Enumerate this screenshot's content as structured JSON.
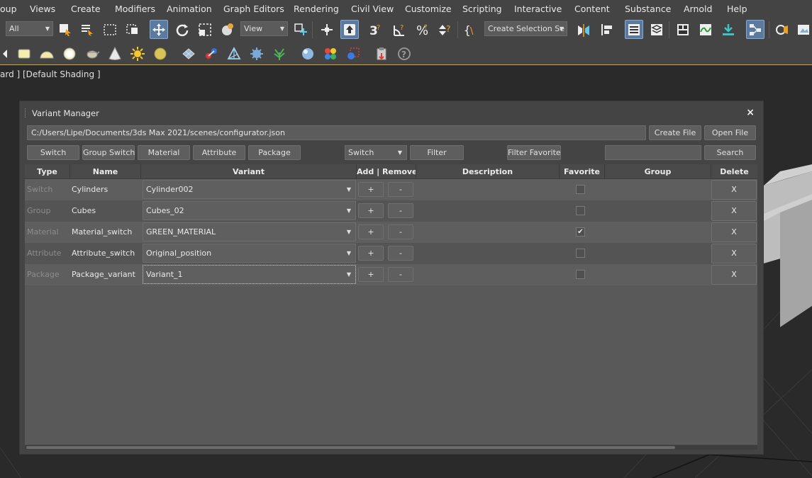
{
  "menubar": {
    "items": [
      "oup",
      "Views",
      "Create",
      "Modifiers",
      "Animation",
      "Graph Editors",
      "Rendering",
      "Civil View",
      "Customize",
      "Scripting",
      "Interactive",
      "Content",
      "Substance",
      "Arnold",
      "Help"
    ]
  },
  "toolbar": {
    "selection_filter": "All",
    "ref_coord": "View",
    "named_selection": "Create Selection Se"
  },
  "viewport": {
    "label": "ard ] [Default Shading ]"
  },
  "dialog": {
    "title": "Variant Manager",
    "close_label": "×",
    "path": "C:/Users/Lipe/Documents/3ds Max 2021/scenes/configurator.json",
    "create_file": "Create File",
    "open_file": "Open File",
    "type_buttons": [
      "Switch",
      "Group Switch",
      "Material",
      "Attribute",
      "Package"
    ],
    "filter_type": "Switch",
    "filter_label": "Filter",
    "filter_favorite_label": "Filter Favorite",
    "search_value": "",
    "search_label": "Search"
  },
  "table": {
    "headers": {
      "type": "Type",
      "name": "Name",
      "variant": "Variant",
      "add_remove": "Add | Remove",
      "description": "Description",
      "favorite": "Favorite",
      "group": "Group",
      "delete": "Delete"
    },
    "rows": [
      {
        "type": "Switch",
        "name": "Cylinders",
        "variant": "Cylinder002",
        "add": "+",
        "remove": "-",
        "favorite": "",
        "delete": "X"
      },
      {
        "type": "Group",
        "name": "Cubes",
        "variant": "Cubes_02",
        "add": "+",
        "remove": "-",
        "favorite": "",
        "delete": "X"
      },
      {
        "type": "Material",
        "name": "Material_switch",
        "variant": "GREEN_MATERIAL",
        "add": "+",
        "remove": "-",
        "favorite": "✔",
        "delete": "X"
      },
      {
        "type": "Attribute",
        "name": "Attribute_switch",
        "variant": "Original_position",
        "add": "+",
        "remove": "-",
        "favorite": "",
        "delete": "X"
      },
      {
        "type": "Package",
        "name": "Package_variant",
        "variant": "Variant_1",
        "add": "+",
        "remove": "-",
        "favorite": "",
        "delete": "X"
      }
    ]
  },
  "icons": [
    "select-icon",
    "select-by-name-icon",
    "rect-region-icon",
    "window-crossing-icon",
    "move-icon",
    "rotate-icon",
    "scale-icon",
    "place-icon",
    "pivot-icon",
    "manipulate-icon",
    "keyboard-shortcut-icon",
    "snap-3d-icon",
    "angle-snap-icon",
    "percent-snap-icon",
    "spinner-snap-icon",
    "edit-named-sets-icon",
    "mirror-icon",
    "align-icon",
    "scene-explorer-icon",
    "layer-explorer-icon",
    "ribbon-icon",
    "curve-editor-icon",
    "dope-sheet-icon",
    "schematic-view-icon",
    "render-setup-icon",
    "rendered-frame-icon"
  ]
}
